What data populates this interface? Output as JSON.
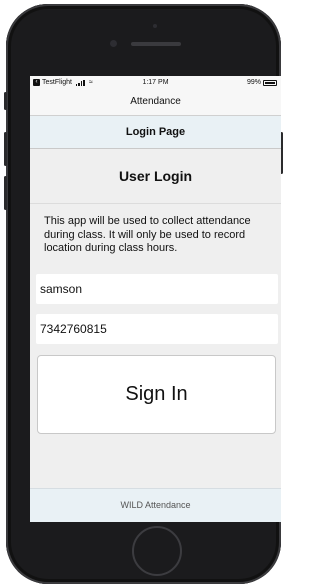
{
  "status_bar": {
    "app_back_label": "TestFlight",
    "time": "1:17 PM",
    "battery": "99%"
  },
  "nav": {
    "title": "Attendance"
  },
  "header": {
    "title": "Login Page"
  },
  "login": {
    "title": "User Login",
    "description": "This app will be used to collect attendance during class. It will only be used to record location during class hours.",
    "username_value": "samson",
    "phone_value": "7342760815",
    "sign_in_label": "Sign In"
  },
  "footer": {
    "text": "WILD Attendance"
  },
  "colors": {
    "header_bg": "#e9f1f5",
    "screen_bg": "#efefef",
    "phone_body": "#1b1b1d"
  }
}
